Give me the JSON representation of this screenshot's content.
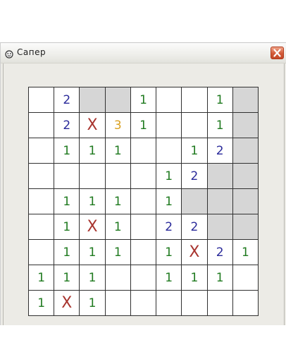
{
  "window": {
    "title": "Сапер"
  },
  "colors": {
    "one": "#1f7a1f",
    "two": "#2a2a9a",
    "three": "#d9a020",
    "mine": "#a8342e",
    "closed": "#d6d6d6",
    "open": "#ffffff"
  },
  "board": {
    "rows": 9,
    "cols": 9,
    "cells": [
      [
        "",
        "2",
        "#",
        "#",
        "1",
        "",
        "",
        "1",
        "#"
      ],
      [
        "",
        "2",
        "X",
        "3",
        "1",
        "",
        "",
        "1",
        "#"
      ],
      [
        "",
        "1",
        "1",
        "1",
        "",
        "",
        "1",
        "2",
        "#"
      ],
      [
        "",
        "",
        "",
        "",
        "",
        "1",
        "2",
        "#",
        "#"
      ],
      [
        "",
        "1",
        "1",
        "1",
        "",
        "1",
        "#",
        "#",
        "#"
      ],
      [
        "",
        "1",
        "X",
        "1",
        "",
        "2",
        "2",
        "#",
        "#"
      ],
      [
        "",
        "1",
        "1",
        "1",
        "",
        "1",
        "X",
        "2",
        "1"
      ],
      [
        "1",
        "1",
        "1",
        "",
        "",
        "1",
        "1",
        "1",
        ""
      ],
      [
        "1",
        "X",
        "1",
        "",
        "",
        "",
        "",
        "",
        ""
      ]
    ]
  }
}
